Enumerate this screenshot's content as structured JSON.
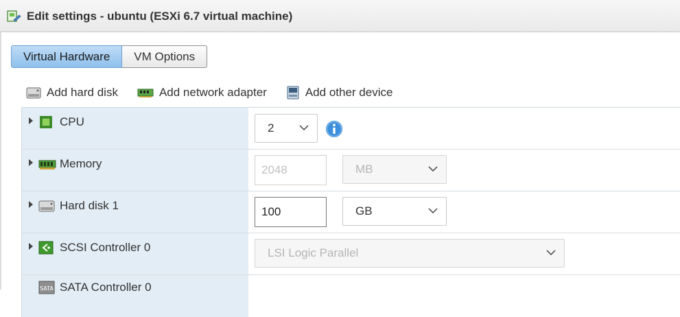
{
  "window": {
    "title": "Edit settings - ubuntu (ESXi 6.7 virtual machine)"
  },
  "tabs": [
    {
      "label": "Virtual Hardware",
      "active": true
    },
    {
      "label": "VM Options",
      "active": false
    }
  ],
  "toolbar": {
    "add_hard_disk": "Add hard disk",
    "add_network_adapter": "Add network adapter",
    "add_other_device": "Add other device"
  },
  "devices": {
    "cpu": {
      "name": "CPU",
      "value": "2",
      "icon": "cpu-icon"
    },
    "memory": {
      "name": "Memory",
      "value": "2048",
      "unit": "MB",
      "icon": "memory-icon"
    },
    "hard_disk": {
      "name": "Hard disk 1",
      "value": "100",
      "unit": "GB",
      "icon": "hard-disk-icon"
    },
    "scsi": {
      "name": "SCSI Controller 0",
      "value": "LSI Logic Parallel",
      "icon": "scsi-controller-icon"
    },
    "sata": {
      "name": "SATA Controller 0",
      "icon": "sata-controller-icon"
    }
  },
  "colors": {
    "active_tab": "#8fc0ec",
    "row_left_bg": "#e3edf5",
    "info_blue": "#3b8fdc",
    "device_green": "#4caf3a"
  }
}
